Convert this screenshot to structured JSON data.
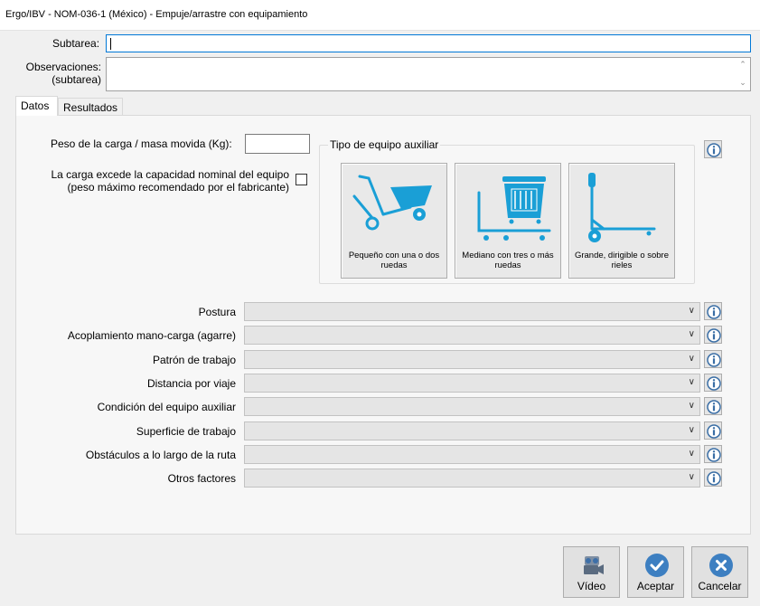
{
  "window": {
    "title": "Ergo/IBV - NOM-036-1 (México) - Empuje/arrastre con equipamiento"
  },
  "header": {
    "subtarea_label": "Subtarea:",
    "subtarea_value": "",
    "observaciones_label_1": "Observaciones:",
    "observaciones_label_2": "(subtarea)",
    "observaciones_value": ""
  },
  "tabs": [
    {
      "label": "Datos",
      "selected": true
    },
    {
      "label": "Resultados",
      "selected": false
    }
  ],
  "datos": {
    "peso_label": "Peso de la carga / masa movida (Kg):",
    "peso_value": "",
    "excede_label_1": "La carga excede la capacidad nominal del equipo",
    "excede_label_2": "(peso máximo recomendado por el fabricante)",
    "excede_checked": false,
    "equipo_group_title": "Tipo de equipo auxiliar",
    "equipos": [
      {
        "line1": "Pequeño con una o dos",
        "line2": "ruedas",
        "icon": "wheelbarrow-icon"
      },
      {
        "line1": "Mediano con tres o más",
        "line2": "ruedas",
        "icon": "cart-icon"
      },
      {
        "line1": "Grande, dirigible o sobre",
        "line2": "rieles",
        "icon": "pallet-jack-icon"
      }
    ],
    "factors": [
      {
        "label": "Postura",
        "value": ""
      },
      {
        "label": "Acoplamiento mano-carga (agarre)",
        "value": ""
      },
      {
        "label": "Patrón de trabajo",
        "value": ""
      },
      {
        "label": "Distancia por viaje",
        "value": ""
      },
      {
        "label": "Condición del equipo auxiliar",
        "value": ""
      },
      {
        "label": "Superficie de trabajo",
        "value": ""
      },
      {
        "label": "Obstáculos a lo largo de la ruta",
        "value": ""
      },
      {
        "label": "Otros factores",
        "value": ""
      }
    ]
  },
  "footer": {
    "video_label": "Vídeo",
    "aceptar_label": "Aceptar",
    "cancelar_label": "Cancelar"
  },
  "colors": {
    "accent": "#1a9fd6",
    "info_icon": "#3a6ea5",
    "accept_circle": "#3d7fc1",
    "cancel_circle": "#3d7fc1"
  }
}
